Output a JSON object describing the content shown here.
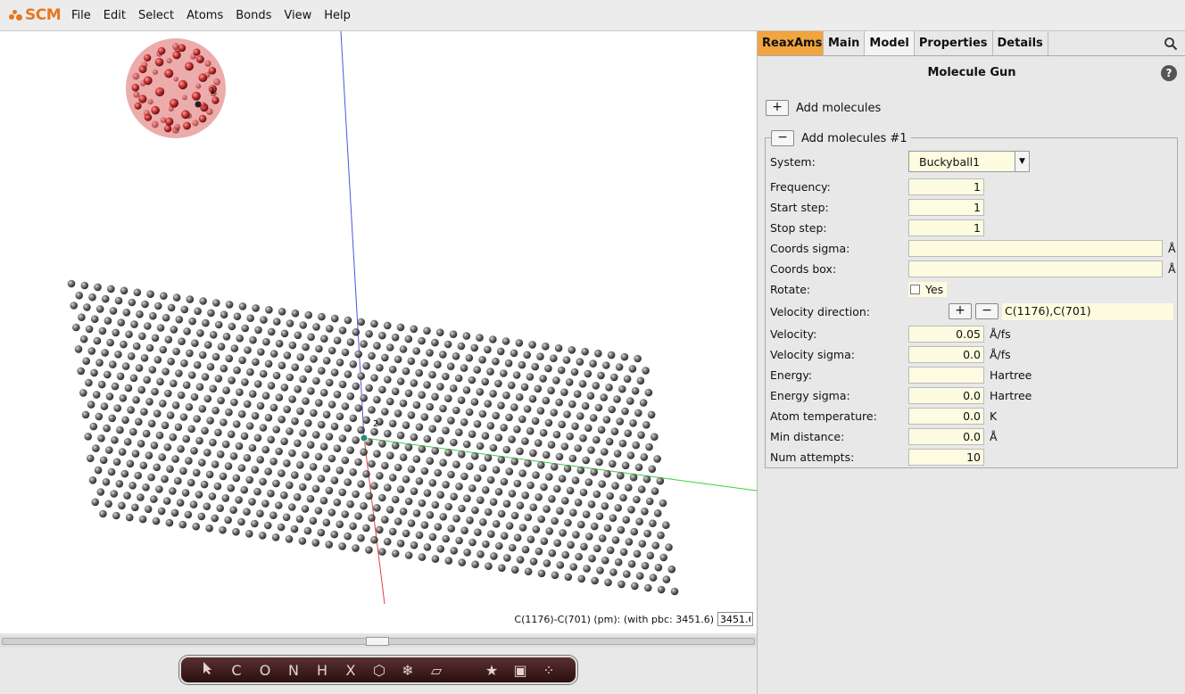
{
  "app": {
    "logo_text": "SCM",
    "menu": [
      {
        "label": "File"
      },
      {
        "label": "Edit"
      },
      {
        "label": "Select"
      },
      {
        "label": "Atoms"
      },
      {
        "label": "Bonds"
      },
      {
        "label": "View"
      },
      {
        "label": "Help"
      }
    ]
  },
  "viewport": {
    "label_buckyball": "1",
    "label_sheet": "2",
    "measure_text": "C(1176)-C(701) (pm): (with pbc: 3451.6)",
    "measure_value": "3451.6"
  },
  "toolbar": {
    "tools": [
      "C",
      "O",
      "N",
      "H",
      "X"
    ]
  },
  "panel": {
    "tabs": [
      {
        "label": "ReaxAms"
      },
      {
        "label": "Main"
      },
      {
        "label": "Model"
      },
      {
        "label": "Properties"
      },
      {
        "label": "Details"
      }
    ],
    "title": "Molecule Gun",
    "help": "?",
    "add_molecules_label": "Add molecules",
    "group_label": "Add molecules #1",
    "system_label": "System:",
    "system_value": "Buckyball1",
    "frequency_label": "Frequency:",
    "frequency_value": "1",
    "start_label": "Start step:",
    "start_value": "1",
    "stop_label": "Stop step:",
    "stop_value": "1",
    "coords_sigma_label": "Coords sigma:",
    "coords_sigma_value": "",
    "coords_sigma_unit": "Å",
    "coords_box_label": "Coords box:",
    "coords_box_value": "",
    "coords_box_unit": "Å",
    "rotate_label": "Rotate:",
    "rotate_yes": "Yes",
    "vdir_label": "Velocity direction:",
    "vdir_value": "C(1176),C(701)",
    "velocity_label": "Velocity:",
    "velocity_value": "0.05",
    "velocity_unit": "Å/fs",
    "vsigma_label": "Velocity sigma:",
    "vsigma_value": "0.0",
    "vsigma_unit": "Å/fs",
    "energy_label": "Energy:",
    "energy_value": "",
    "energy_unit": "Hartree",
    "esigma_label": "Energy sigma:",
    "esigma_value": "0.0",
    "esigma_unit": "Hartree",
    "atemp_label": "Atom temperature:",
    "atemp_value": "0.0",
    "atemp_unit": "K",
    "mindist_label": "Min distance:",
    "mindist_value": "0.0",
    "mindist_unit": "Å",
    "attempts_label": "Num attempts:",
    "attempts_value": "10"
  },
  "colors": {
    "brand": "#e8771e",
    "engine_tab": "#f0a540",
    "field_bg": "#fdfbe0"
  }
}
